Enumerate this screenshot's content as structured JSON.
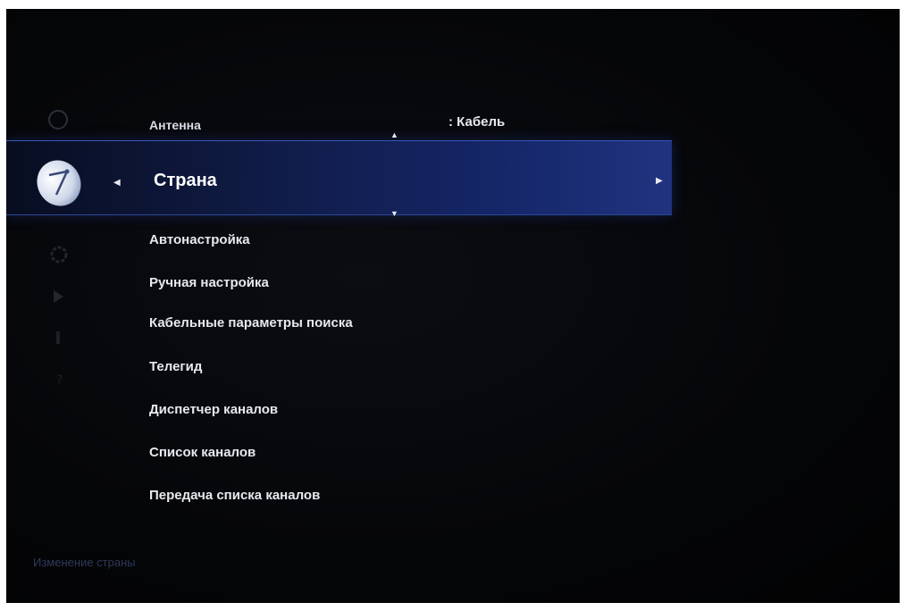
{
  "menu": {
    "antenna_label": "Антенна",
    "antenna_value": ": Кабель",
    "selected_label": "Страна",
    "items": [
      "Автонастройка",
      "Ручная настройка",
      "Кабельные  параметры поиска",
      "Телегид",
      "Диспетчер каналов",
      "Список каналов",
      "Передача списка каналов"
    ]
  },
  "help_text": "Изменение страны",
  "icons": [
    "broadcast-icon",
    "satellite-dish-icon",
    "settings-icon",
    "play-icon",
    "app-icon",
    "help-icon"
  ],
  "colors": {
    "highlight": "#1a2f8a",
    "text": "#e7e9ef",
    "background": "#050608"
  }
}
